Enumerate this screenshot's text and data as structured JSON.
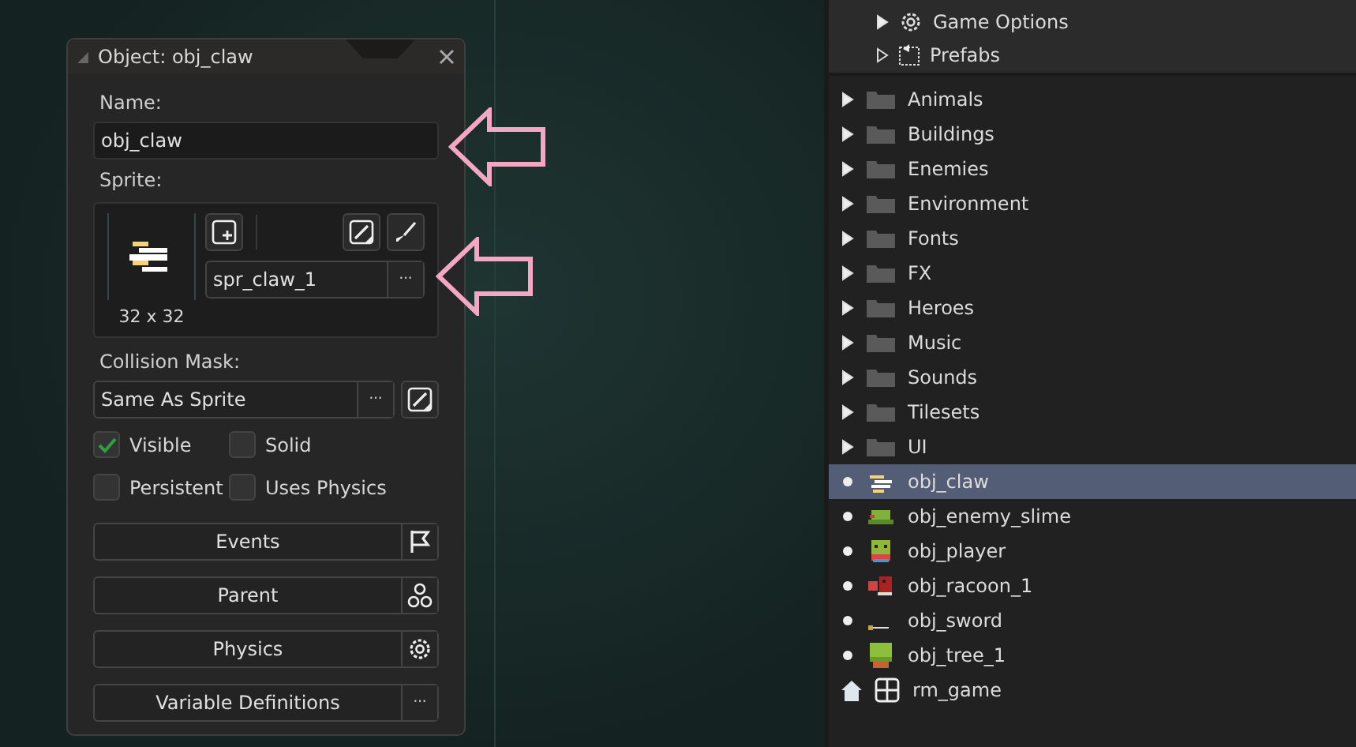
{
  "object_editor": {
    "title": "Object: obj_claw",
    "name_label": "Name:",
    "name_value": "obj_claw",
    "sprite_label": "Sprite:",
    "sprite_name": "spr_claw_1",
    "sprite_more": "···",
    "sprite_size": "32 x 32",
    "collision_label": "Collision Mask:",
    "collision_value": "Same As Sprite",
    "collision_more": "···",
    "checkboxes": [
      {
        "label": "Visible",
        "checked": true
      },
      {
        "label": "Solid",
        "checked": false
      },
      {
        "label": "Persistent",
        "checked": false
      },
      {
        "label": "Uses Physics",
        "checked": false
      }
    ],
    "buttons": [
      {
        "label": "Events",
        "kind": "flag"
      },
      {
        "label": "Parent",
        "kind": "parent"
      },
      {
        "label": "Physics",
        "kind": "gear"
      },
      {
        "label": "Variable Definitions",
        "kind": "more",
        "text": "···"
      }
    ]
  },
  "asset_tree": {
    "top_items": [
      {
        "label": "Game Options",
        "kind": "gear",
        "empty": false
      },
      {
        "label": "Prefabs",
        "kind": "prefab",
        "empty": true
      }
    ],
    "items": [
      {
        "label": "Animals",
        "kind": "folder",
        "selected": false
      },
      {
        "label": "Buildings",
        "kind": "folder",
        "selected": false
      },
      {
        "label": "Enemies",
        "kind": "folder",
        "selected": false
      },
      {
        "label": "Environment",
        "kind": "folder",
        "selected": false
      },
      {
        "label": "Fonts",
        "kind": "folder",
        "selected": false
      },
      {
        "label": "FX",
        "kind": "folder",
        "selected": false
      },
      {
        "label": "Heroes",
        "kind": "folder",
        "selected": false
      },
      {
        "label": "Music",
        "kind": "folder",
        "selected": false
      },
      {
        "label": "Sounds",
        "kind": "folder",
        "selected": false
      },
      {
        "label": "Tilesets",
        "kind": "folder",
        "selected": false
      },
      {
        "label": "UI",
        "kind": "folder",
        "selected": false
      },
      {
        "label": "obj_claw",
        "kind": "claw",
        "selected": true
      },
      {
        "label": "obj_enemy_slime",
        "kind": "slime",
        "selected": false
      },
      {
        "label": "obj_player",
        "kind": "player",
        "selected": false
      },
      {
        "label": "obj_racoon_1",
        "kind": "racoon",
        "selected": false
      },
      {
        "label": "obj_sword",
        "kind": "sword",
        "selected": false
      },
      {
        "label": "obj_tree_1",
        "kind": "tree",
        "selected": false
      },
      {
        "label": "rm_game",
        "kind": "room",
        "selected": false
      }
    ]
  }
}
